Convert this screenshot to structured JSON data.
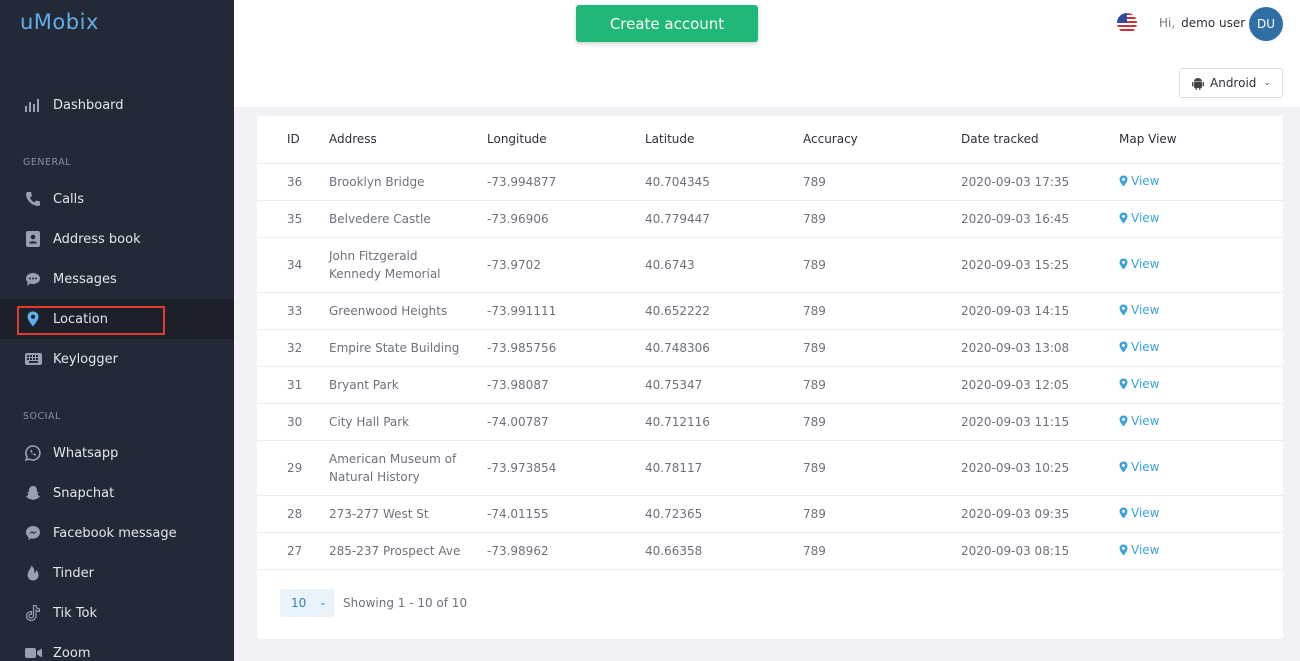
{
  "app": {
    "logo": "uMobix"
  },
  "sidebar": {
    "dashboard": "Dashboard",
    "general_label": "GENERAL",
    "general": [
      "Calls",
      "Address book",
      "Messages",
      "Location",
      "Keylogger"
    ],
    "social_label": "SOCIAL",
    "social": [
      "Whatsapp",
      "Snapchat",
      "Facebook message",
      "Tinder",
      "Tik Tok",
      "Zoom"
    ],
    "active": "Location"
  },
  "header": {
    "create_account": "Create account",
    "hi": "Hi,",
    "user": "demo user",
    "avatar": "DU"
  },
  "device": {
    "selected": "Android"
  },
  "table": {
    "columns": [
      "ID",
      "Address",
      "Longitude",
      "Latitude",
      "Accuracy",
      "Date tracked",
      "Map View"
    ],
    "rows": [
      {
        "id": "36",
        "address": "Brooklyn Bridge",
        "lon": "-73.994877",
        "lat": "40.704345",
        "acc": "789",
        "date": "2020-09-03 17:35",
        "view": "View"
      },
      {
        "id": "35",
        "address": "Belvedere Castle",
        "lon": "-73.96906",
        "lat": "40.779447",
        "acc": "789",
        "date": "2020-09-03 16:45",
        "view": "View"
      },
      {
        "id": "34",
        "address": "John Fitzgerald Kennedy Memorial",
        "lon": "-73.9702",
        "lat": "40.6743",
        "acc": "789",
        "date": "2020-09-03 15:25",
        "view": "View"
      },
      {
        "id": "33",
        "address": "Greenwood Heights",
        "lon": "-73.991111",
        "lat": "40.652222",
        "acc": "789",
        "date": "2020-09-03 14:15",
        "view": "View"
      },
      {
        "id": "32",
        "address": "Empire State Building",
        "lon": "-73.985756",
        "lat": "40.748306",
        "acc": "789",
        "date": "2020-09-03 13:08",
        "view": "View"
      },
      {
        "id": "31",
        "address": "Bryant Park",
        "lon": "-73.98087",
        "lat": "40.75347",
        "acc": "789",
        "date": "2020-09-03 12:05",
        "view": "View"
      },
      {
        "id": "30",
        "address": "City Hall Park",
        "lon": "-74.00787",
        "lat": "40.712116",
        "acc": "789",
        "date": "2020-09-03 11:15",
        "view": "View"
      },
      {
        "id": "29",
        "address": "American Museum of Natural History",
        "lon": "-73.973854",
        "lat": "40.78117",
        "acc": "789",
        "date": "2020-09-03 10:25",
        "view": "View"
      },
      {
        "id": "28",
        "address": "273-277 West St",
        "lon": "-74.01155",
        "lat": "40.72365",
        "acc": "789",
        "date": "2020-09-03 09:35",
        "view": "View"
      },
      {
        "id": "27",
        "address": "285-237 Prospect Ave",
        "lon": "-73.98962",
        "lat": "40.66358",
        "acc": "789",
        "date": "2020-09-03 08:15",
        "view": "View"
      }
    ]
  },
  "pagination": {
    "page_size": "10",
    "showing": "Showing 1 - 10 of 10"
  },
  "colors": {
    "sidebar": "#232936",
    "accent": "#1fb876",
    "link": "#3ba3d9",
    "highlight": "#e03b2f"
  }
}
